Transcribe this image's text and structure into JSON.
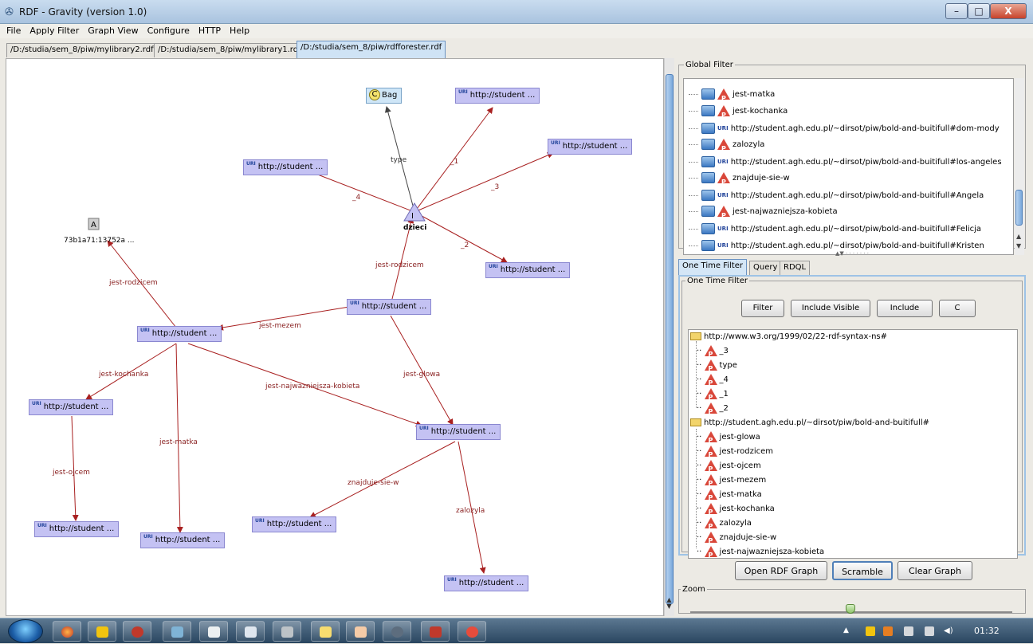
{
  "window": {
    "title": "RDF - Gravity (version 1.0)",
    "min": "–",
    "max": "□",
    "close": "X"
  },
  "menu": [
    "File",
    "Apply Filter",
    "Graph View",
    "Configure",
    "HTTP",
    "Help"
  ],
  "doc_tabs": [
    {
      "label": "/D:/studia/sem_8/piw/mylibrary2.rdf",
      "active": false
    },
    {
      "label": "/D:/studia/sem_8/piw/mylibrary1.rdf",
      "active": false
    },
    {
      "label": "/D:/studia/sem_8/piw/rdfforester.rdf",
      "active": true
    }
  ],
  "graph": {
    "uri_badge": "URI",
    "bag_icon": "C",
    "nodes": {
      "bag": "Bag",
      "n1": "http://student ...",
      "n2": "http://student ...",
      "n3": "http://student ...",
      "n4": "http://student ...",
      "n5": "http://student ...",
      "n6": "http://student ...",
      "n7": "http://student ...",
      "n8": "http://student ...",
      "n9": "http://student ...",
      "n10": "http://student ...",
      "n11": "http://student ...",
      "n12": "http://student ...",
      "n13": "http://student ..."
    },
    "instance_symbol": "I",
    "instance_label": "dzieci",
    "anon_symbol": "A",
    "anon_label": "73b1a71:13752a ...",
    "edges": {
      "type": "type",
      "e1": "_1",
      "e2": "_2",
      "e3": "_3",
      "e4": "_4",
      "rodzicem1": "jest-rodzicem",
      "rodzicem2": "jest-rodzicem",
      "mezem": "jest-mezem",
      "glowa": "jest-glowa",
      "kochanka": "jest-kochanka",
      "najwazniejsza": "jest-najwazniejsza-kobieta",
      "matka": "jest-matka",
      "ojcem": "jest-ojcem",
      "znajduje": "znajduje-sie-w",
      "zalozyla": "zalozyla"
    }
  },
  "global_filter": {
    "legend": "Global Filter",
    "items": [
      {
        "kind": "prop",
        "label": "jest-matka"
      },
      {
        "kind": "prop",
        "label": "jest-kochanka"
      },
      {
        "kind": "uri",
        "label": "http://student.agh.edu.pl/~dirsot/piw/bold-and-buitifull#dom-mody"
      },
      {
        "kind": "prop",
        "label": "zalozyla"
      },
      {
        "kind": "uri",
        "label": "http://student.agh.edu.pl/~dirsot/piw/bold-and-buitifull#los-angeles"
      },
      {
        "kind": "prop",
        "label": "znajduje-sie-w"
      },
      {
        "kind": "uri",
        "label": "http://student.agh.edu.pl/~dirsot/piw/bold-and-buitifull#Angela"
      },
      {
        "kind": "prop",
        "label": "jest-najwazniejsza-kobieta"
      },
      {
        "kind": "uri",
        "label": "http://student.agh.edu.pl/~dirsot/piw/bold-and-buitifull#Felicja"
      },
      {
        "kind": "uri",
        "label": "http://student.agh.edu.pl/~dirsot/piw/bold-and-buitifull#Kristen"
      }
    ]
  },
  "filter_tabs": [
    "One Time Filter",
    "Query",
    "RDQL"
  ],
  "one_time_filter": {
    "legend": "One Time Filter",
    "buttons": {
      "filter": "Filter",
      "include_visible": "Include Visible",
      "include": "Include",
      "c": "C"
    },
    "ns1": "http://www.w3.org/1999/02/22-rdf-syntax-ns#",
    "ns1_items": [
      "_3",
      "type",
      "_4",
      "_1",
      "_2"
    ],
    "ns2": "http://student.agh.edu.pl/~dirsot/piw/bold-and-buitifull#",
    "ns2_items": [
      "jest-glowa",
      "jest-rodzicem",
      "jest-ojcem",
      "jest-mezem",
      "jest-matka",
      "jest-kochanka",
      "zalozyla",
      "znajduje-sie-w",
      "jest-najwazniejsza-kobieta"
    ]
  },
  "actions": {
    "open": "Open RDF Graph",
    "scramble": "Scramble",
    "clear": "Clear Graph"
  },
  "zoom": {
    "legend": "Zoom",
    "level": 0.5
  },
  "taskbar": {
    "clock": "01:32"
  }
}
